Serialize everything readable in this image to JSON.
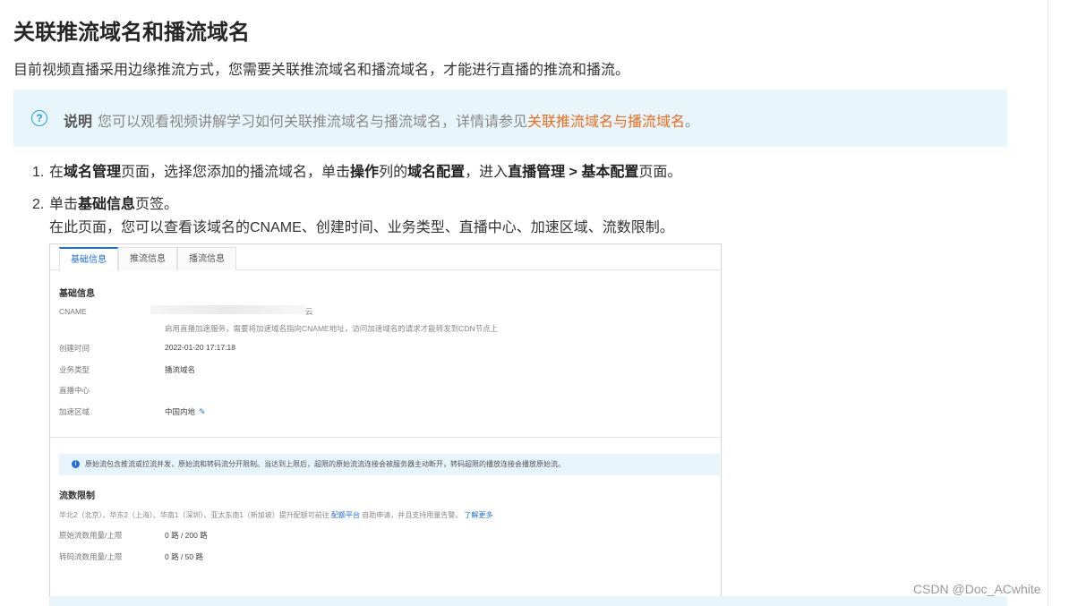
{
  "title": "关联推流域名和播流域名",
  "intro": "目前视频直播采用边缘推流方式，您需要关联推流域名和播流域名，才能进行直播的推流和播流。",
  "note": {
    "icon": "question-circle-icon",
    "label": "说明",
    "text": "您可以观看视频讲解学习如何关联推流域名与播流域名，详情请参见",
    "link": "关联推流域名与播流域名",
    "end": "。",
    "link_color": "#ef6c1e"
  },
  "steps": [
    {
      "num": "1.",
      "parts": [
        "在",
        "域名管理",
        "页面，选择您添加的播流域名，单击",
        "操作",
        "列的",
        "域名配置",
        "，进入",
        "直播管理 > 基本配置",
        "页面。"
      ]
    },
    {
      "num": "2.",
      "parts": [
        "单击",
        "基础信息",
        "页签。"
      ],
      "sub": "在此页面，您可以查看该域名的CNAME、创建时间、业务类型、直播中心、加速区域、流数限制。"
    }
  ],
  "screenshot": {
    "tabs": [
      "基础信息",
      "推流信息",
      "播流信息"
    ],
    "basic": {
      "title": "基础信息",
      "cname_label": "CNAME",
      "cname_tail": "云",
      "cname_hint": "启用直播加速服务，需要将加速域名指向CNAME地址，访问加速域名的请求才能转发到CDN节点上",
      "created_label": "创建时间",
      "created_value": "2022-01-20 17:17:18",
      "type_label": "业务类型",
      "type_value": "播流域名",
      "center_label": "直播中心",
      "region_label": "加速区域",
      "region_value": "中国内地"
    },
    "info_text": "原始流包含推流或拉流并发，原始流和转码流分开限制。当达到上限后，超限的原始流流连接会被服务器主动断开，转码超限的播放连接会播放原始流。",
    "limits": {
      "title": "流数限制",
      "note_pre": "华北2（北京）、华东2（上海）、华南1（深圳）、亚太东南1（新加坡）提升配额可前往",
      "note_link": "配额平台",
      "note_mid": "自助申请，并且支持用量告警。",
      "note_more": "了解更多",
      "orig_label": "原始流数用量/上限",
      "orig_value": "0 路 / 200 路",
      "trans_label": "转码流数用量/上限",
      "trans_value": "0 路 / 50 路"
    }
  },
  "watermark": "CSDN @Doc_ACwhite",
  "accent_color": "#1e6fe0"
}
